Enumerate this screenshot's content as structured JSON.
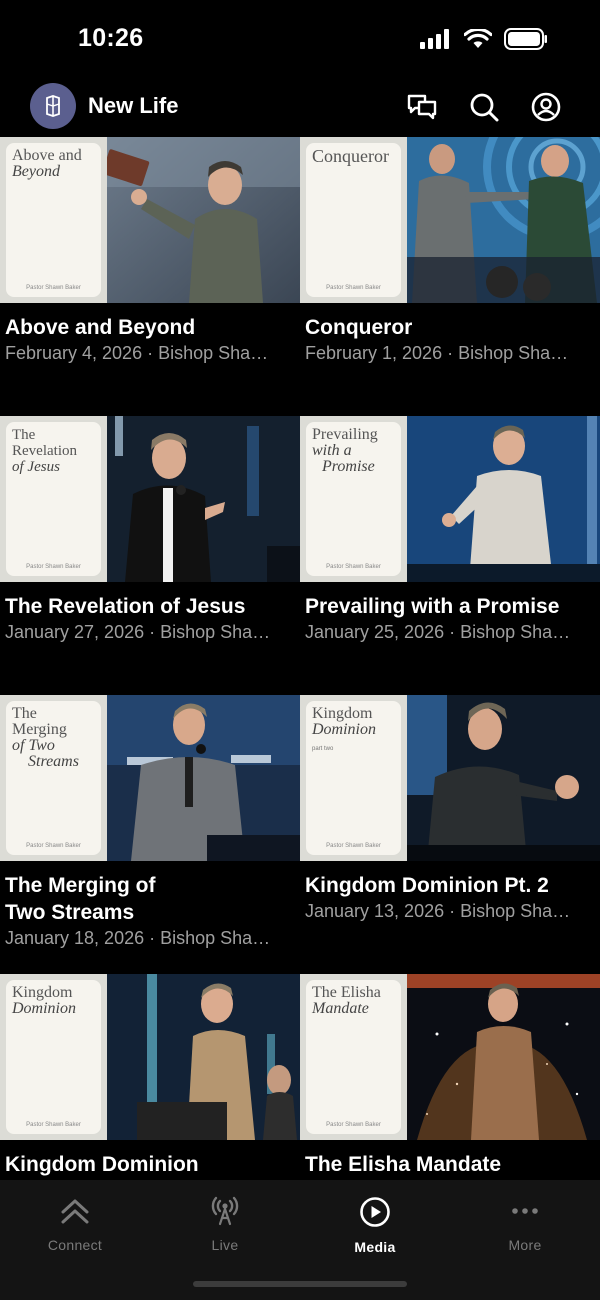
{
  "status": {
    "time": "10:26"
  },
  "header": {
    "title": "New Life",
    "logo": "church-logo",
    "icons": [
      "chat-bubbles-icon",
      "search-icon",
      "profile-icon"
    ]
  },
  "book_author": "Pastor Shawn Baker",
  "cards": [
    {
      "title": "Above and Beyond",
      "meta": "February 4, 2026 · Bishop Sha…",
      "book_line1": "Above and",
      "book_line2": "Beyond",
      "book_sub": ""
    },
    {
      "title": "Conqueror",
      "meta": "February 1, 2026 · Bishop Sha…",
      "book_line1": "Conqueror",
      "book_line2": "",
      "book_sub": ""
    },
    {
      "title": "The Revelation of Jesus",
      "meta": "January 27, 2026 · Bishop Sha…",
      "book_line1": "The Revelation",
      "book_line2": "of Jesus",
      "book_sub": ""
    },
    {
      "title": "Prevailing with a Promise",
      "meta": "January 25, 2026 · Bishop Sha…",
      "book_line1": "Prevailing",
      "book_line2": "with a",
      "book_line3": "Promise",
      "book_sub": ""
    },
    {
      "title": "The Merging of",
      "title2": "Two Streams",
      "meta": "January 18, 2026 · Bishop Sha…",
      "book_line1": "The Merging",
      "book_line2": "of Two",
      "book_line3": "Streams",
      "book_sub": ""
    },
    {
      "title": "Kingdom Dominion Pt. 2",
      "meta": "January 13, 2026 · Bishop Sha…",
      "book_line1": "Kingdom",
      "book_line2": "Dominion",
      "book_sub": "part two"
    },
    {
      "title": "Kingdom Dominion",
      "meta": "",
      "book_line1": "Kingdom",
      "book_line2": "Dominion",
      "book_sub": ""
    },
    {
      "title": "The Elisha Mandate",
      "meta": "",
      "book_line1": "The Elisha",
      "book_line2": "Mandate",
      "book_sub": ""
    }
  ],
  "tabs": [
    {
      "label": "Connect",
      "icon": "double-chevron-up-icon",
      "active": false
    },
    {
      "label": "Live",
      "icon": "broadcast-icon",
      "active": false
    },
    {
      "label": "Media",
      "icon": "play-circle-icon",
      "active": true
    },
    {
      "label": "More",
      "icon": "more-dots-icon",
      "active": false
    }
  ],
  "colors": {
    "background": "#000000",
    "meta_text": "#a0a0a0",
    "tab_inactive": "#7a7a7a",
    "logo_bg": "#5b5f8f"
  }
}
